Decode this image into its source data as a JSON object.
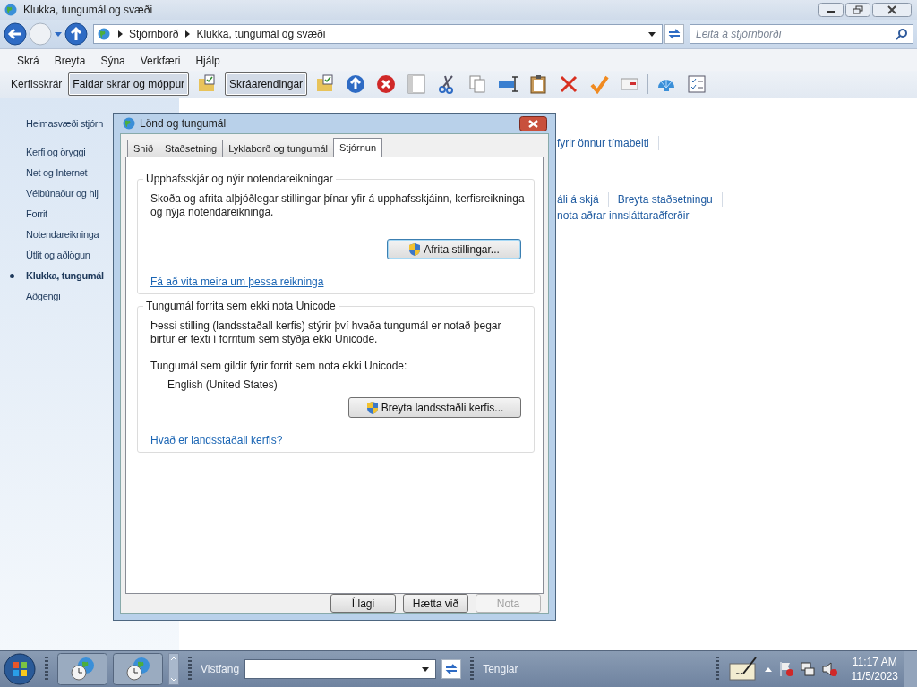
{
  "window": {
    "title": "Klukka, tungumál og svæði"
  },
  "address_bar": {
    "breadcrumb": [
      "Stjórnborð",
      "Klukka, tungumál og svæði"
    ],
    "search_placeholder": "Leita á stjórnborði"
  },
  "menu": [
    "Skrá",
    "Breyta",
    "Sýna",
    "Verkfæri",
    "Hjálp"
  ],
  "toolbar": {
    "label": "Kerfisskrár",
    "toggles": [
      {
        "label": "Faldar skrár og möppur",
        "on": true
      },
      {
        "label": "Skráarendingar",
        "on": true
      }
    ]
  },
  "sidebar": {
    "items": [
      {
        "label": "Heimasvæði stjórn",
        "selected": false
      },
      {
        "label": "Kerfi og öryggi",
        "selected": false
      },
      {
        "label": "Net og Internet",
        "selected": false
      },
      {
        "label": "Vélbúnaður og hlj",
        "selected": false
      },
      {
        "label": "Forrit",
        "selected": false
      },
      {
        "label": "Notendareikninga",
        "selected": false
      },
      {
        "label": "Útlit og aðlögun",
        "selected": false
      },
      {
        "label": "Klukka, tungumál",
        "selected": true
      },
      {
        "label": "Aðgengi",
        "selected": false
      }
    ]
  },
  "content": {
    "link_rows": [
      [
        "fyrir önnur tímabelti"
      ],
      [
        "áli á skjá",
        "Breyta staðsetningu"
      ],
      [
        "nota aðrar innsláttaraðferðir"
      ]
    ]
  },
  "dialog": {
    "title": "Lönd og tungumál",
    "tabs": [
      {
        "label": "Snið",
        "selected": false
      },
      {
        "label": "Staðsetning",
        "selected": false
      },
      {
        "label": "Lyklaborð og tungumál",
        "selected": false
      },
      {
        "label": "Stjórnun",
        "selected": true
      }
    ],
    "groups": [
      {
        "title": "Upphafsskjár og nýir notendareikningar",
        "text": "Skoða og afrita alþjóðlegar stillingar þínar yfir á upphafsskjáinn, kerfisreikninga og nýja notendareikninga.",
        "button": "Afrita stillingar...",
        "link": "Fá að vita meira um þessa reikninga"
      },
      {
        "title": "Tungumál forrita sem ekki nota Unicode",
        "text": "Þessi stilling (landsstaðall kerfis) stýrir því hvaða tungumál er notað þegar birtur er texti í forritum sem styðja ekki Unicode.",
        "label": "Tungumál sem gildir fyrir forrit sem nota ekki Unicode:",
        "value": "English (United States)",
        "button": "Breyta landsstaðli kerfis...",
        "link": "Hvað er landsstaðall kerfis?"
      }
    ],
    "buttons": [
      {
        "label": "Í lagi",
        "disabled": false
      },
      {
        "label": "Hætta við",
        "disabled": false
      },
      {
        "label": "Nota",
        "disabled": true
      }
    ]
  },
  "taskbar": {
    "address_label": "Vistfang",
    "links_label": "Tenglar",
    "time": "11:17 AM",
    "date": "11/5/2023"
  }
}
